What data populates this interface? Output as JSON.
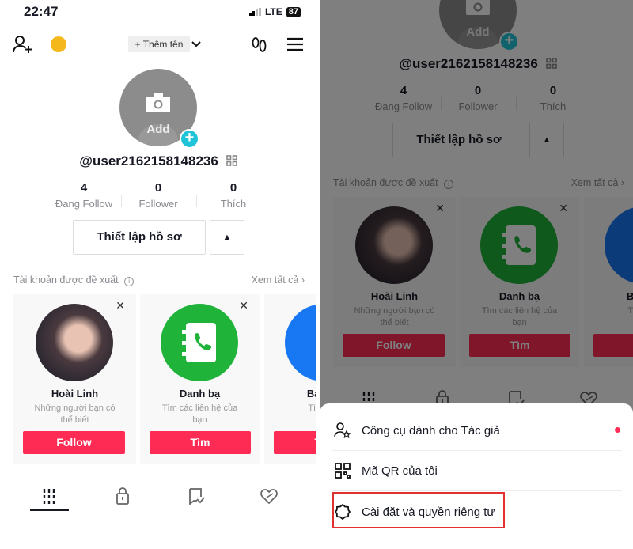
{
  "status_bar": {
    "time": "22:47",
    "network": "LTE",
    "battery": "87"
  },
  "top_nav": {
    "add_name": "+ Thêm tên",
    "icons": [
      "add-user-icon",
      "coin-icon",
      "chevron-down-icon",
      "footprints-icon",
      "hamburger-menu-icon"
    ]
  },
  "profile": {
    "avatar_label": "Add",
    "handle": "@user2162158148236",
    "stats": [
      {
        "value": "4",
        "label": "Đang Follow"
      },
      {
        "value": "0",
        "label": "Follower"
      },
      {
        "value": "0",
        "label": "Thích"
      }
    ],
    "edit_button": "Thiết lập hồ sơ",
    "more_button": "▲"
  },
  "suggested": {
    "title": "Tài khoản được đề xuất",
    "see_all": "Xem tất cả",
    "cards": [
      {
        "name": "Hoài Linh",
        "desc": "Những người bạn có thể biết",
        "button": "Follow"
      },
      {
        "name": "Danh bạ",
        "desc": "Tìm các liên hệ của bạn",
        "button": "Tìm"
      },
      {
        "name": "Bạn bè",
        "desc": "Tìm bạn",
        "button": "Tìm"
      }
    ]
  },
  "tabs": [
    "videos-grid",
    "private-lock",
    "reposts",
    "liked"
  ],
  "menu": {
    "items": [
      {
        "label": "Công cụ dành cho Tác giả",
        "icon": "creator-tools-icon",
        "badge": true
      },
      {
        "label": "Mã QR của tôi",
        "icon": "qr-code-icon"
      },
      {
        "label": "Cài đặt và quyền riêng tư",
        "icon": "settings-gear-icon",
        "highlighted": true
      }
    ]
  },
  "colors": {
    "accent": "#fe2c55",
    "teal": "#20c4d8",
    "contacts_green": "#1fb33a",
    "facebook_blue": "#1877f2",
    "highlight_box": "#e03030"
  }
}
